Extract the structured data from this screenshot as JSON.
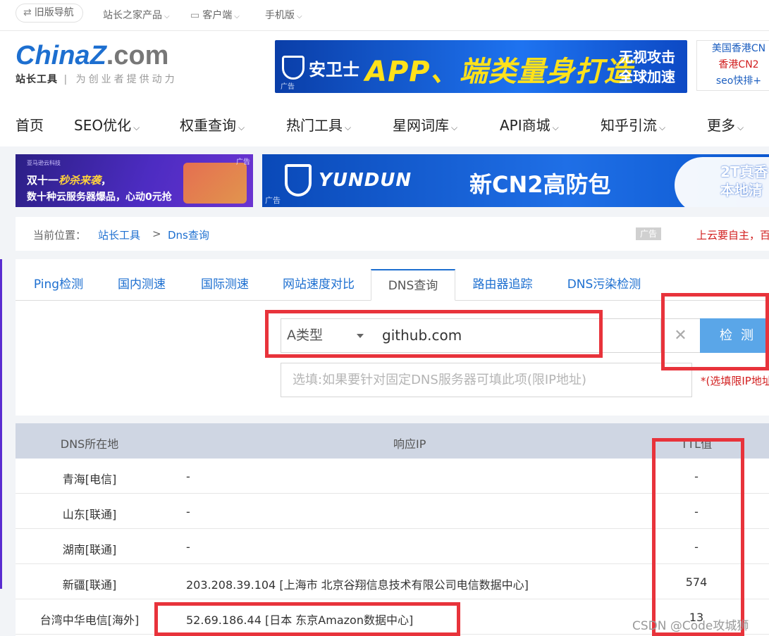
{
  "topbar": {
    "old_nav": "旧版导航",
    "links": [
      "站长之家产品",
      "客户端",
      "手机版"
    ]
  },
  "logo": {
    "main_part1": "China",
    "main_part2": "Z",
    "main_part3": ".com",
    "tagline_bold": "站长工具",
    "tagline": "为创业者提供动力"
  },
  "banner_ad": {
    "brand": "安卫士",
    "slogan": "APP、端类量身打造",
    "side_line1": "无视攻击",
    "side_line2": "全球加速",
    "ad_tag": "广告"
  },
  "right_ad": {
    "line1": "美国香港CN",
    "line2": "香港CN2",
    "line3": "seo快排+"
  },
  "main_nav": [
    "首页",
    "SEO优化",
    "权重查询",
    "热门工具",
    "星网词库",
    "API商城",
    "知乎引流",
    "更多"
  ],
  "ad_strip_left": {
    "company": "亚马逊云科技",
    "line1_a": "双十一",
    "line1_b": "秒杀来袭",
    "line1_c": "，",
    "line2": "数十种云服务器爆品，心动0元抢",
    "ad_tag": "广告"
  },
  "ad_strip_right": {
    "brand": "YUNDUN",
    "title": "新CN2高防包",
    "right_line1": "2T真香",
    "right_line2": "本地清",
    "ad_tag": "广告"
  },
  "breadcrumb": {
    "label": "当前位置：",
    "link1": "站长工具",
    "sep": ">",
    "link2": "Dns查询",
    "ad_badge": "广告",
    "promo": "上云要自主，百"
  },
  "tabs": [
    "Ping检测",
    "国内测速",
    "国际测速",
    "网站速度对比",
    "DNS查询",
    "路由器追踪",
    "DNS污染检测"
  ],
  "active_tab": "DNS查询",
  "query": {
    "type_value": "A类型",
    "domain_value": "github.com",
    "clear_symbol": "✕",
    "check_label": "检测",
    "dns_placeholder": "选填:如果要针对固定DNS服务器可填此项(限IP地址)",
    "note": "*(选填限IP地址)"
  },
  "results": {
    "headers": [
      "DNS所在地",
      "响应IP",
      "TTL值"
    ],
    "rows": [
      {
        "location": "青海[电信]",
        "ip": "-",
        "ttl": "-"
      },
      {
        "location": "山东[联通]",
        "ip": "-",
        "ttl": "-"
      },
      {
        "location": "湖南[联通]",
        "ip": "-",
        "ttl": "-"
      },
      {
        "location": "新疆[联通]",
        "ip": "203.208.39.104 [上海市 北京谷翔信息技术有限公司电信数据中心]",
        "ttl": "574"
      },
      {
        "location": "台湾中华电信[海外]",
        "ip": "52.69.186.44 [日本 东京Amazon数据中心]",
        "ttl": "13"
      }
    ]
  },
  "watermark": "CSDN @Code攻城狮",
  "colors": {
    "accent": "#1d6fd0",
    "button": "#5aa6e8",
    "highlight": "#e8333b",
    "table_header": "#cfd6e3"
  }
}
